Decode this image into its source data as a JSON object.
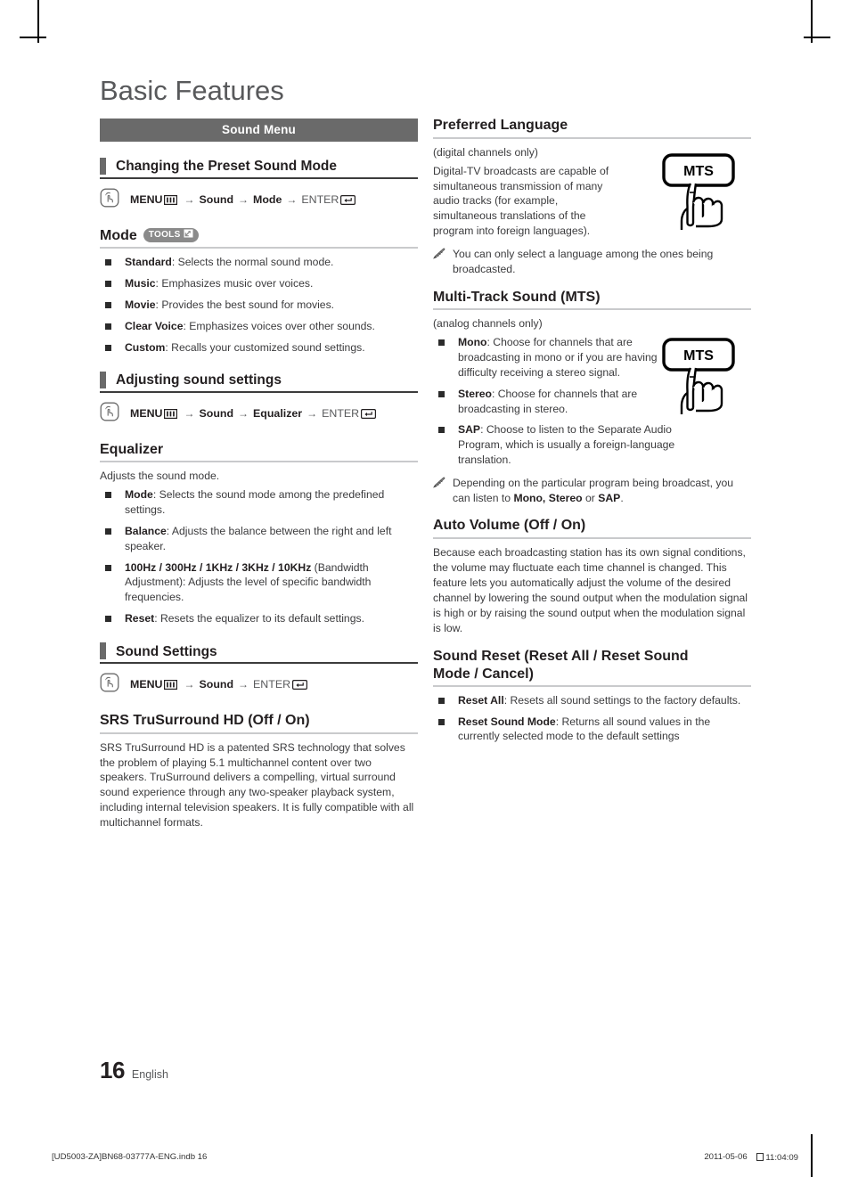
{
  "page": {
    "chapter_title": "Basic Features",
    "page_number": "16",
    "language_label": "English"
  },
  "menu_bar": {
    "label": "Sound Menu"
  },
  "icons": {
    "press": "hand-press-icon",
    "menu": "menu-bars-icon",
    "enter": "enter-return-icon",
    "tools_arrow": "tools-arrow-icon",
    "note": "pencil-note-icon",
    "remote_button": "mts-remote-button-icon"
  },
  "left_column": {
    "section_changing_mode": {
      "heading": "Changing the Preset Sound Mode",
      "nav": {
        "menu": "MENU",
        "steps": [
          "Sound",
          "Mode"
        ],
        "enter": "ENTER",
        "arrow": "→"
      }
    },
    "mode": {
      "heading": "Mode",
      "badge": "TOOLS",
      "items": [
        {
          "term": "Standard",
          "desc": ": Selects the normal sound mode."
        },
        {
          "term": "Music",
          "desc": ": Emphasizes music over voices."
        },
        {
          "term": "Movie",
          "desc": ": Provides the best sound for movies."
        },
        {
          "term": "Clear Voice",
          "desc": ": Emphasizes voices over other sounds."
        },
        {
          "term": "Custom",
          "desc": ": Recalls your customized sound settings."
        }
      ]
    },
    "section_adjusting": {
      "heading": "Adjusting sound settings",
      "nav": {
        "menu": "MENU",
        "steps": [
          "Sound",
          "Equalizer"
        ],
        "enter": "ENTER",
        "arrow": "→"
      }
    },
    "equalizer": {
      "heading": "Equalizer",
      "intro": "Adjusts the sound mode.",
      "items": [
        {
          "term": "Mode",
          "desc": ": Selects the sound mode among the predefined settings."
        },
        {
          "term": "Balance",
          "desc": ": Adjusts the balance between the right and left speaker."
        },
        {
          "term": "100Hz / 300Hz / 1KHz / 3KHz / 10KHz",
          "desc": " (Bandwidth Adjustment): Adjusts the level of specific bandwidth frequencies."
        },
        {
          "term": "Reset",
          "desc": ": Resets the equalizer to its default settings."
        }
      ]
    },
    "section_sound_settings": {
      "heading": "Sound Settings",
      "nav": {
        "menu": "MENU",
        "steps": [
          "Sound"
        ],
        "enter": "ENTER",
        "arrow": "→"
      }
    },
    "srs": {
      "heading": "SRS TruSurround HD (Off / On)",
      "body": "SRS TruSurround HD is a patented SRS technology that solves the problem of playing 5.1 multichannel content over two speakers. TruSurround delivers a compelling, virtual surround sound experience through any two-speaker playback system, including internal television speakers. It is fully compatible with all multichannel formats."
    }
  },
  "right_column": {
    "preferred_language": {
      "heading": "Preferred Language",
      "sub": "(digital channels only)",
      "body": "Digital-TV broadcasts are capable of simultaneous transmission of many audio tracks (for example, simultaneous translations of the program into foreign languages).",
      "note": "You can only select a language among the ones being broadcasted.",
      "remote_label": "MTS"
    },
    "mts": {
      "heading": "Multi-Track Sound (MTS)",
      "sub": "(analog channels only)",
      "items": [
        {
          "term": "Mono",
          "desc": ": Choose for channels that are broadcasting in mono or if you are having difficulty receiving a stereo signal."
        },
        {
          "term": "Stereo",
          "desc": ": Choose for channels that are broadcasting in stereo."
        },
        {
          "term": "SAP",
          "desc": ": Choose to listen to the Separate Audio Program, which is usually a foreign-language translation."
        }
      ],
      "note_prefix": "Depending on the particular program being broadcast, you can listen to ",
      "note_bold1": "Mono, Stereo",
      "note_mid": " or ",
      "note_bold2": "SAP",
      "note_suffix": ".",
      "remote_label": "MTS"
    },
    "auto_volume": {
      "heading": "Auto Volume (Off / On)",
      "body": "Because each broadcasting station has its own signal conditions, the volume may fluctuate each time channel is changed. This feature lets you automatically adjust the volume of the desired channel by lowering the sound output when the modulation signal is high or by raising the sound output when the modulation signal is low."
    },
    "sound_reset": {
      "heading_line1": "Sound Reset (Reset All / Reset Sound",
      "heading_line2": "Mode / Cancel)",
      "items": [
        {
          "term": "Reset All",
          "desc": ": Resets all sound settings to the factory defaults."
        },
        {
          "term": "Reset Sound Mode",
          "desc": ": Returns all sound values in the currently selected mode to the default settings"
        }
      ]
    }
  },
  "colophon": {
    "file": "[UD5003-ZA]BN68-03777A-ENG.indb   16",
    "date": "2011-05-06",
    "time": "11:04:09"
  },
  "colors": {
    "bar_gray": "#6a6a6a",
    "title_gray": "#58595b",
    "rule_gray": "#c9cacc",
    "text": "#231f20"
  }
}
